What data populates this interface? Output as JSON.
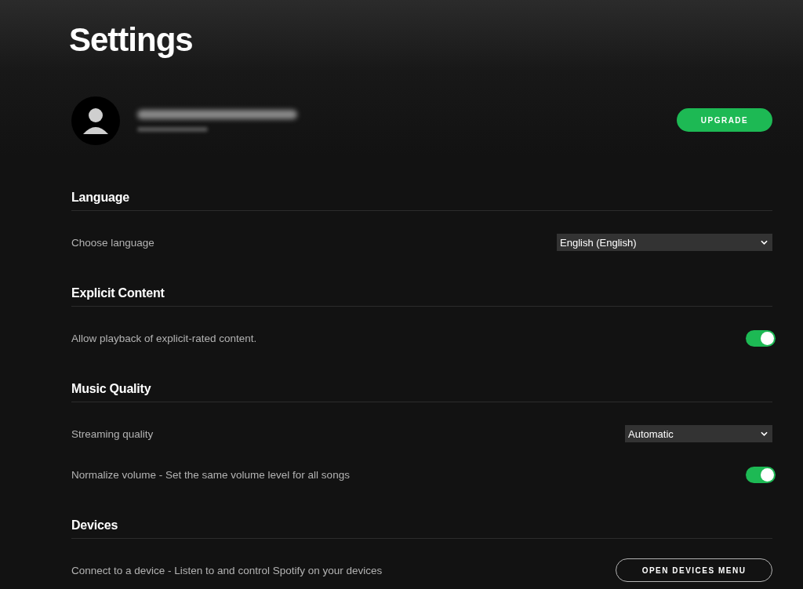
{
  "page": {
    "title": "Settings"
  },
  "profile": {
    "upgrade_button": "UPGRADE"
  },
  "sections": [
    {
      "heading": "Language",
      "rows": [
        {
          "kind": "select",
          "label": "Choose language",
          "value": "English (English)"
        }
      ]
    },
    {
      "heading": "Explicit Content",
      "rows": [
        {
          "kind": "toggle",
          "label": "Allow playback of explicit-rated content.",
          "on": true
        }
      ]
    },
    {
      "heading": "Music Quality",
      "rows": [
        {
          "kind": "select",
          "label": "Streaming quality",
          "value": "Automatic"
        },
        {
          "kind": "toggle",
          "label": "Normalize volume - Set the same volume level for all songs",
          "on": true
        }
      ]
    },
    {
      "heading": "Devices",
      "rows": [
        {
          "kind": "button",
          "label": "Connect to a device - Listen to and control Spotify on your devices",
          "button": "OPEN DEVICES MENU"
        }
      ]
    }
  ]
}
